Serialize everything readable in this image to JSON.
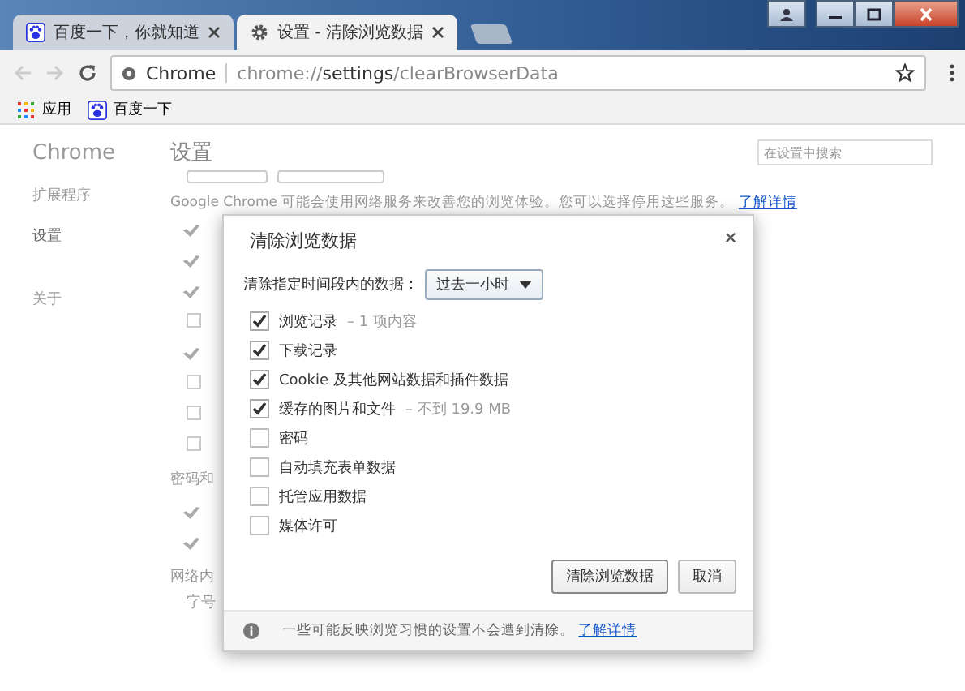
{
  "tabs": [
    {
      "title": "百度一下，你就知道",
      "selected": false
    },
    {
      "title": "设置 - 清除浏览数据",
      "selected": true
    }
  ],
  "address": {
    "site": "Chrome",
    "url_prefix": "chrome://",
    "url_host": "settings",
    "url_path": "/clearBrowserData"
  },
  "bookmarks": [
    {
      "label": "应用"
    },
    {
      "label": "百度一下"
    }
  ],
  "sidebar": {
    "title": "Chrome",
    "items": [
      {
        "label": "扩展程序",
        "selected": false
      },
      {
        "label": "设置",
        "selected": true
      },
      {
        "label": "关于",
        "selected": false
      }
    ]
  },
  "page": {
    "title": "设置",
    "search_placeholder": "在设置中搜索",
    "notice": "Google Chrome 可能会使用网络服务来改善您的浏览体验。您可以选择停用这些服务。",
    "notice_link": "了解详情",
    "privacy_checks": [
      true,
      true,
      true,
      false,
      true,
      false,
      false,
      false
    ],
    "section_2": "密码和",
    "section_2_checks": [
      true,
      true
    ],
    "section_3": "网络内",
    "row_label": "字号"
  },
  "dialog": {
    "title": "清除浏览数据",
    "range_label": "清除指定时间段内的数据：",
    "range_value": "过去一小时",
    "options": [
      {
        "label": "浏览记录",
        "detail": "– 1 项内容",
        "checked": true
      },
      {
        "label": "下载记录",
        "checked": true
      },
      {
        "label": "Cookie 及其他网站数据和插件数据",
        "checked": true
      },
      {
        "label": "缓存的图片和文件",
        "detail": "– 不到 19.9 MB",
        "checked": true
      },
      {
        "label": "密码",
        "checked": false
      },
      {
        "label": "自动填充表单数据",
        "checked": false
      },
      {
        "label": "托管应用数据",
        "checked": false
      },
      {
        "label": "媒体许可",
        "checked": false
      }
    ],
    "buttons": [
      "清除浏览数据",
      "取消"
    ],
    "footer": "一些可能反映浏览习惯的设置不会遭到清除。",
    "footer_link": "了解详情"
  }
}
